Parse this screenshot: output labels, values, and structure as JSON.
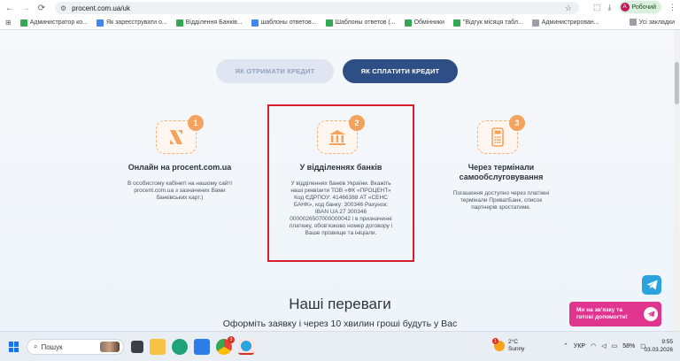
{
  "browser": {
    "url": "procent.com.ua/uk",
    "profile_label": "Робочий",
    "profile_initial": "A",
    "bookmarks": [
      {
        "label": "Администратор ко...",
        "color": "#34a853"
      },
      {
        "label": "Як зареєструвати о...",
        "color": "#4285f4"
      },
      {
        "label": "Відділення Банків...",
        "color": "#34a853"
      },
      {
        "label": "шаблоны ответов...",
        "color": "#4285f4"
      },
      {
        "label": "Шаблоны ответов (...",
        "color": "#34a853"
      },
      {
        "label": "Обмінники",
        "color": "#34a853"
      },
      {
        "label": "\"Відгук місяця табл...",
        "color": "#34a853"
      },
      {
        "label": "Администрирован...",
        "color": "#9aa0a6"
      }
    ],
    "all_bookmarks_label": "Усі закладки"
  },
  "page": {
    "tabs": {
      "get_credit": "ЯК ОТРИМАТИ КРЕДИТ",
      "pay_credit": "ЯК СПЛАТИТИ КРЕДИТ"
    },
    "methods": [
      {
        "number": "1",
        "title": "Онлайн на procent.com.ua",
        "description": "В особистому кабінеті на нашому сайті procent.com.ua з зазначених Вами банківських карт.)",
        "icon": "logo-icon"
      },
      {
        "number": "2",
        "title": "У відділеннях банків",
        "description": "У відділеннях банків України. Вкажіть наші реквізити ТОВ «ФК «ПРОЦЕНТ» Код ЄДРПОУ: 41466388 АТ «СЕНС БАНК», код банку: 300346 Рахунок: IBAN UA 27 300346 0000026507000000042 і в призначенні платежу, обов'язково номер договору і Ваше прізвище та ініціали.",
        "icon": "bank-icon"
      },
      {
        "number": "3",
        "title": "Через термінали самообслуговування",
        "description": "Погашення доступно через платіжні термінали ПриватБанк, список партнерів зростатиме.",
        "icon": "terminal-icon"
      }
    ],
    "advantages_title": "Наші переваги",
    "advantages_subtitle": "Оформіть заявку і через 10 хвилин гроші будуть у Вас",
    "chat_widget_text": "Ми на зв'язку та готові допомогти!"
  },
  "taskbar": {
    "search_placeholder": "Пошук",
    "weather_temp": "2°C",
    "weather_desc": "Sunny",
    "weather_badge": "1",
    "language": "УКР",
    "battery": "58%",
    "time": "9:55",
    "date": "03.03.2026",
    "edge_badge": "3"
  },
  "colors": {
    "accent_dark": "#2e4f86",
    "accent_orange": "#f4a35f",
    "highlight_red": "#d61f2a",
    "chat_pink": "#e0358f",
    "telegram_blue": "#2aa3df"
  }
}
